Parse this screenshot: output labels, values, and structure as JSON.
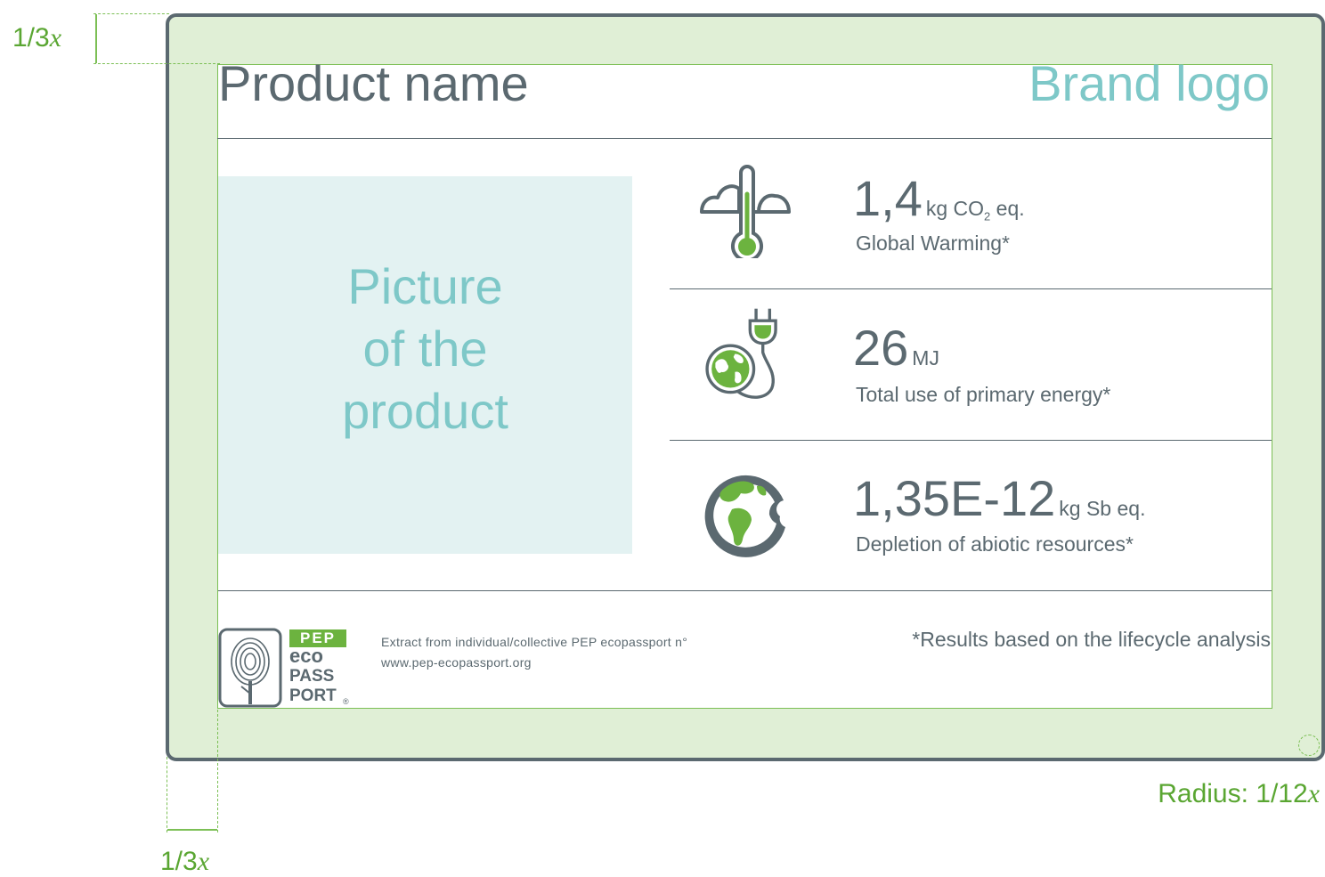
{
  "header": {
    "product_name": "Product name",
    "brand_logo": "Brand logo"
  },
  "picture": {
    "text": "Picture\nof the\nproduct"
  },
  "indicators": [
    {
      "icon": "thermometer-cloud-icon",
      "value": "1,4",
      "unit_pre": "kg CO",
      "unit_sub": "2",
      "unit_post": " eq.",
      "label": "Global Warming*"
    },
    {
      "icon": "globe-plug-icon",
      "value": "26",
      "unit": "MJ",
      "label": "Total use of primary energy*"
    },
    {
      "icon": "bitten-globe-icon",
      "value": "1,35E-12",
      "unit": "kg Sb eq.",
      "label": "Depletion of abiotic resources*"
    }
  ],
  "footer": {
    "logo": {
      "line1": "PEP",
      "line2": "eco",
      "line3": "PASS",
      "line4": "PORT",
      "mark": "®"
    },
    "extract_line": "Extract from individual/collective PEP ecopassport n°",
    "url": "www.pep-ecopassport.org",
    "footnote": "*Results based on the lifecycle analysis"
  },
  "annotations": {
    "margin_top": {
      "num": "1/3",
      "var": "x"
    },
    "margin_left": {
      "num": "1/3",
      "var": "x"
    },
    "radius": {
      "prefix": "Radius: 1/12",
      "var": "x"
    }
  },
  "colors": {
    "frame_fill": "#e0efd6",
    "frame_border": "#5b6970",
    "text_dark": "#5b6970",
    "accent_teal": "#7ec8c8",
    "accent_green": "#6cb33f"
  }
}
